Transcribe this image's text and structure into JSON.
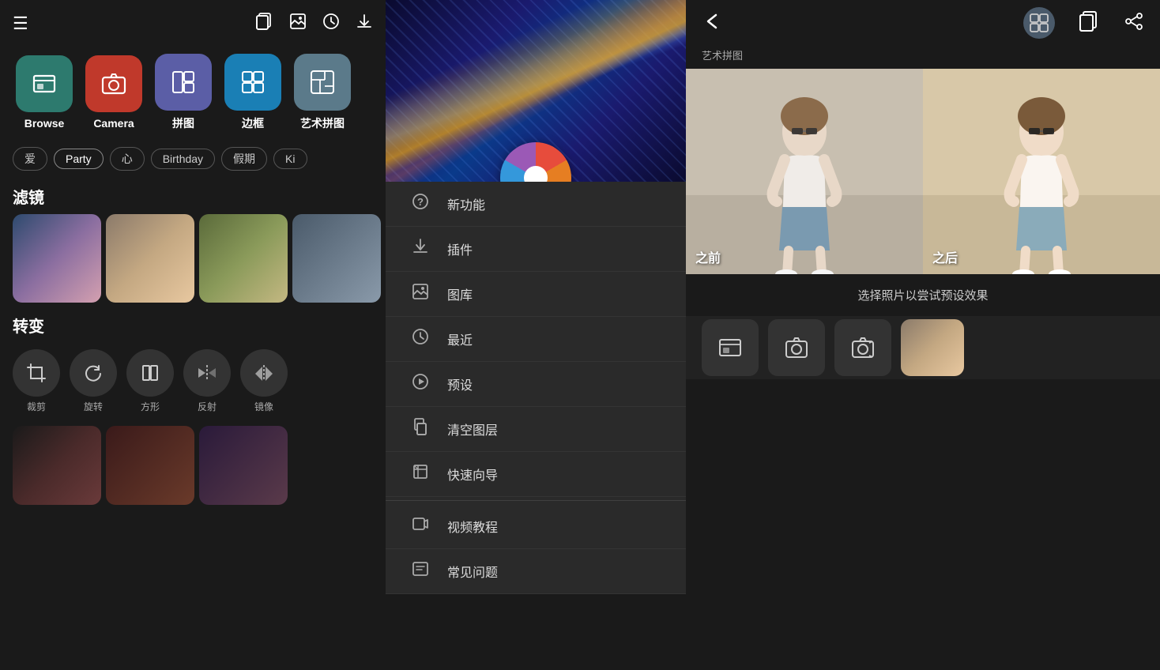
{
  "leftPanel": {
    "topBar": {
      "menuIcon": "☰",
      "copyWindowIcon": "❐",
      "galleryIcon": "🖼",
      "historyIcon": "◷",
      "downloadIcon": "⬇"
    },
    "toolButtons": [
      {
        "id": "browse",
        "label": "Browse",
        "icon": "⊞",
        "bgClass": "bg-teal"
      },
      {
        "id": "camera",
        "label": "Camera",
        "icon": "📷",
        "bgClass": "bg-red"
      },
      {
        "id": "pinjian",
        "label": "拼图",
        "icon": "⊟",
        "bgClass": "bg-purple"
      },
      {
        "id": "biankuang",
        "label": "边框",
        "icon": "▣",
        "bgClass": "bg-blue"
      },
      {
        "id": "artpinjian",
        "label": "艺术拼图",
        "icon": "🖼",
        "bgClass": "bg-gray-blue"
      }
    ],
    "tags": [
      "爱",
      "Party",
      "心",
      "Birthday",
      "假期",
      "Ki"
    ],
    "filterSection": {
      "title": "滤镜"
    },
    "transformSection": {
      "title": "转变",
      "buttons": [
        {
          "id": "crop",
          "label": "裁剪",
          "icon": "⊡"
        },
        {
          "id": "rotate",
          "label": "旋转",
          "icon": "↻"
        },
        {
          "id": "square",
          "label": "方形",
          "icon": "⊞"
        },
        {
          "id": "reflect",
          "label": "反射",
          "icon": "⊠"
        },
        {
          "id": "mirror",
          "label": "镜像",
          "icon": "▷◁"
        }
      ]
    }
  },
  "middlePanel": {
    "menuItems": [
      {
        "id": "new-features",
        "label": "新功能",
        "icon": "?"
      },
      {
        "id": "plugins",
        "label": "插件",
        "icon": "⬇"
      },
      {
        "id": "gallery",
        "label": "图库",
        "icon": "🖼"
      },
      {
        "id": "recent",
        "label": "最近",
        "icon": "◷"
      },
      {
        "id": "presets",
        "label": "预设",
        "icon": "▷"
      },
      {
        "id": "clear-layers",
        "label": "清空图层",
        "icon": "❐"
      },
      {
        "id": "quick-guide",
        "label": "快速向导",
        "icon": "❐"
      },
      {
        "id": "video-tutorial",
        "label": "视频教程",
        "icon": "≡"
      },
      {
        "id": "faq",
        "label": "常见问题",
        "icon": "≡"
      }
    ]
  },
  "rightPanel": {
    "topBar": {
      "backIcon": "←",
      "duplicateIcon": "⧉",
      "shareIcon": "⤴"
    },
    "artCollageLabel": "艺术拼图",
    "comparison": {
      "beforeLabel": "之前",
      "afterLabel": "之后"
    },
    "infoText": "选择照片以尝试预设效果",
    "bottomToolbar": {
      "icons": [
        "⊡",
        "📷",
        "⊟"
      ]
    }
  }
}
